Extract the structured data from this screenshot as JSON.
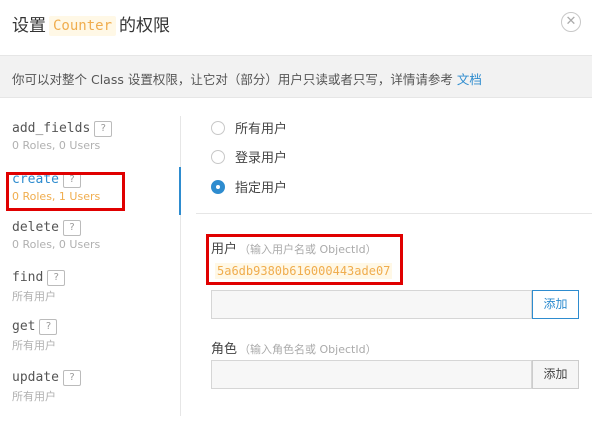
{
  "header": {
    "title_prefix": "设置",
    "class_name": "Counter",
    "title_suffix": "的权限",
    "close_glyph": "✕"
  },
  "info": {
    "text": "你可以对整个 Class 设置权限，让它对（部分）用户只读或者只写，详情请参考",
    "link": "文档"
  },
  "operations": [
    {
      "name": "add_fields",
      "sub": "0 Roles, 0 Users",
      "active": false
    },
    {
      "name": "create",
      "sub": "0 Roles, 1 Users",
      "active": true
    },
    {
      "name": "delete",
      "sub": "0 Roles, 0 Users",
      "active": false
    },
    {
      "name": "find",
      "sub": "所有用户",
      "active": false
    },
    {
      "name": "get",
      "sub": "所有用户",
      "active": false
    },
    {
      "name": "update",
      "sub": "所有用户",
      "active": false
    }
  ],
  "help_glyph": "?",
  "radios": [
    {
      "label": "所有用户",
      "checked": false
    },
    {
      "label": "登录用户",
      "checked": false
    },
    {
      "label": "指定用户",
      "checked": true
    }
  ],
  "users": {
    "label": "用户",
    "hint": "（输入用户名或 ObjectId）",
    "entries": [
      "5a6db9380b616000443ade07"
    ],
    "input_value": "",
    "add_label": "添加"
  },
  "roles": {
    "label": "角色",
    "hint": "（输入角色名或 ObjectId）",
    "input_value": "",
    "add_label": "添加"
  },
  "colors": {
    "accent": "#2e8ccf",
    "class_highlight": "#f0ad4e",
    "annotation_red": "#e00000"
  }
}
